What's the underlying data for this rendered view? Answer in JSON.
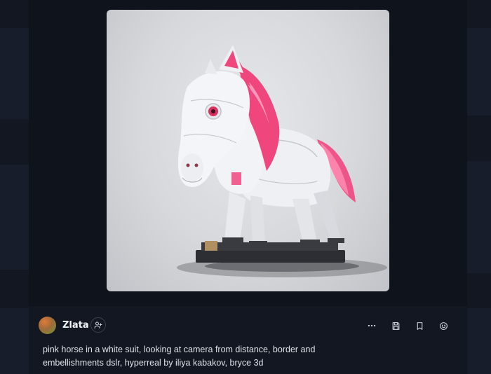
{
  "user": {
    "name": "Zlata"
  },
  "post": {
    "prompt": "pink horse in a white suit, looking at camera from distance, border and embellishments dslr, hyperreal by iliya kabakov, bryce 3d"
  },
  "icons": {
    "follow": "user-plus-icon",
    "more": "more-horizontal-icon",
    "save": "save-icon",
    "bookmark": "bookmark-icon",
    "react": "smile-icon"
  },
  "colors": {
    "background": "#0b0f17",
    "panel": "#121722",
    "accent_pink": "#f0467e"
  }
}
